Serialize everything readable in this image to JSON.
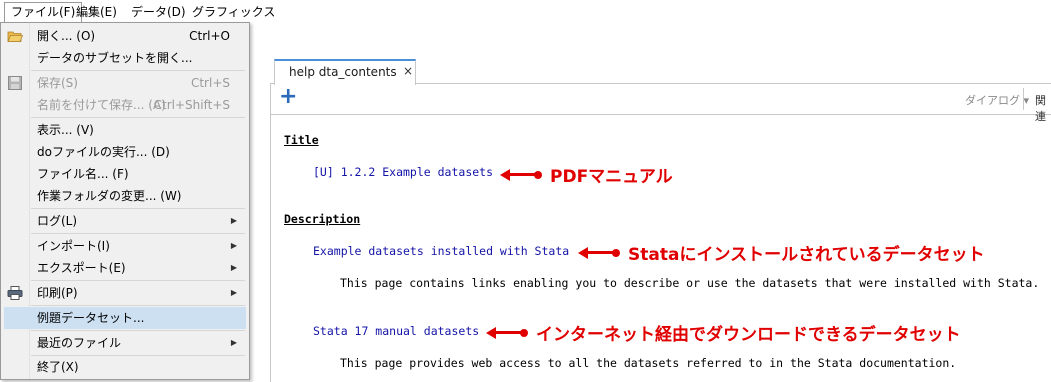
{
  "menubar": [
    "ファイル(F)",
    "編集(E)",
    "データ(D)",
    "グラフィックス"
  ],
  "file_menu": {
    "items": [
      {
        "label": "開く... (O)",
        "shortcut": "Ctrl+O",
        "icon": "open-folder-icon"
      },
      {
        "label": "データのサブセットを開く..."
      },
      {
        "label": "保存(S)",
        "shortcut": "Ctrl+S",
        "icon": "save-disk-icon",
        "disabled": true
      },
      {
        "label": "名前を付けて保存... (A)",
        "shortcut": "Ctrl+Shift+S",
        "disabled": true
      },
      {
        "label": "表示... (V)"
      },
      {
        "label": "doファイルの実行... (D)"
      },
      {
        "label": "ファイル名... (F)"
      },
      {
        "label": "作業フォルダの変更... (W)"
      },
      {
        "label": "ログ(L)",
        "submenu": true
      },
      {
        "label": "インポート(I)",
        "submenu": true
      },
      {
        "label": "エクスポート(E)",
        "submenu": true
      },
      {
        "label": "印刷(P)",
        "submenu": true,
        "icon": "printer-icon"
      },
      {
        "label": "例題データセット...",
        "selected": true
      },
      {
        "label": "最近のファイル",
        "submenu": true
      },
      {
        "label": "終了(X)"
      }
    ]
  },
  "help_tab": {
    "title": "help dta_contents",
    "close": "×"
  },
  "toolbar": {
    "plus": "+",
    "dialog": "ダイアログ ▾",
    "related": "関連"
  },
  "content": {
    "title_heading": "Title",
    "manual_link": "[U] 1.2.2 Example datasets",
    "desc_heading": "Description",
    "installed_link": "Example datasets installed with Stata",
    "installed_text": "This page contains links enabling you to describe or use the datasets that were installed with Stata.",
    "manual_datasets_link": "Stata 17 manual datasets",
    "manual_datasets_text": "This page provides web access to all the datasets referred to in the Stata documentation."
  },
  "annotations": {
    "a1": "PDFマニュアル",
    "a2": "Stataにインストールされているデータセット",
    "a3": "インターネット経由でダウンロードできるデータセット"
  },
  "colors": {
    "link": "#1414a8",
    "annotation": "#e00000",
    "selection": "#cce0f2",
    "tab_accent": "#4a90d9"
  }
}
